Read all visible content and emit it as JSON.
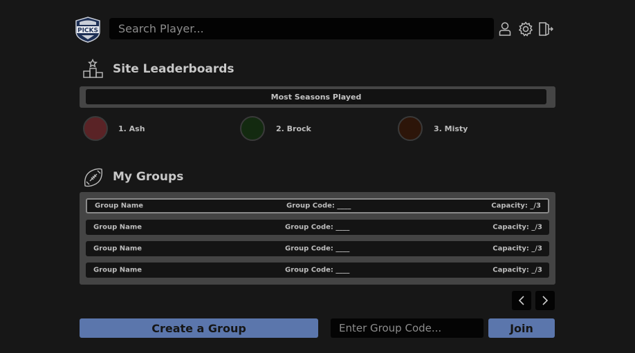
{
  "header": {
    "logo_text": "PICKS",
    "search_placeholder": "Search Player..."
  },
  "icons": {
    "profile": "user-icon",
    "settings": "gear-icon",
    "logout": "exit-door-icon",
    "leaderboard": "podium-icon",
    "groups": "football-icon"
  },
  "leaderboards": {
    "title": "Site Leaderboards",
    "category": "Most Seasons Played",
    "ranks": [
      {
        "label": "1. Ash",
        "color": "#5a2326"
      },
      {
        "label": "2. Brock",
        "color": "#132a10"
      },
      {
        "label": "3. Misty",
        "color": "#2d1509"
      }
    ]
  },
  "groups": {
    "title": "My Groups",
    "rows": [
      {
        "name": "Group Name",
        "code": "Group Code: ____",
        "capacity": "Capacity: _/3"
      },
      {
        "name": "Group Name",
        "code": "Group Code: ____",
        "capacity": "Capacity: _/3"
      },
      {
        "name": "Group Name",
        "code": "Group Code: ____",
        "capacity": "Capacity: _/3"
      },
      {
        "name": "Group Name",
        "code": "Group Code: ____",
        "capacity": "Capacity: _/3"
      }
    ]
  },
  "actions": {
    "create_label": "Create a Group",
    "code_placeholder": "Enter Group Code...",
    "join_label": "Join"
  },
  "colors": {
    "accent": "#5b76ac",
    "background": "#171717",
    "panel": "#444444"
  }
}
